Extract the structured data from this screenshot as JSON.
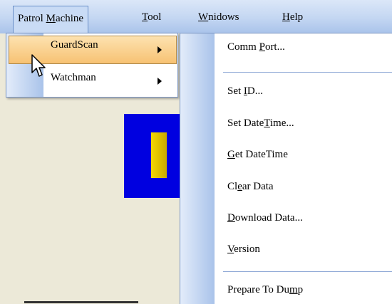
{
  "menubar": {
    "items": [
      {
        "pre": "Patrol ",
        "u": "M",
        "post": "achine"
      },
      {
        "pre": "",
        "u": "T",
        "post": "ool"
      },
      {
        "pre": "",
        "u": "W",
        "post": "nidows"
      },
      {
        "pre": "",
        "u": "H",
        "post": "elp"
      }
    ]
  },
  "patrol_menu": {
    "items": [
      {
        "label": "GuardScan",
        "highlighted": true
      },
      {
        "label": "Watchman",
        "highlighted": false
      }
    ]
  },
  "guardscan_submenu": {
    "items": [
      {
        "pre": "Comm ",
        "u": "P",
        "post": "ort..."
      },
      {
        "pre": "Set ",
        "u": "I",
        "post": "D..."
      },
      {
        "pre": "Set Date",
        "u": "T",
        "post": "ime..."
      },
      {
        "pre": "",
        "u": "G",
        "post": "et DateTime"
      },
      {
        "pre": "Cl",
        "u": "e",
        "post": "ar Data"
      },
      {
        "pre": "",
        "u": "D",
        "post": "ownload Data..."
      },
      {
        "pre": "",
        "u": "V",
        "post": "ersion"
      },
      {
        "pre": "Prepare To Du",
        "u": "m",
        "post": "p"
      }
    ]
  },
  "colors": {
    "highlight": "#f7c273",
    "menubar": "#c3d6f2",
    "app_bg": "#ECE9D8",
    "logo_blue": "#0000e0",
    "logo_yellow": "#f5d800"
  },
  "icons": [
    "mouse-cursor-icon",
    "submenu-arrow-icon"
  ]
}
